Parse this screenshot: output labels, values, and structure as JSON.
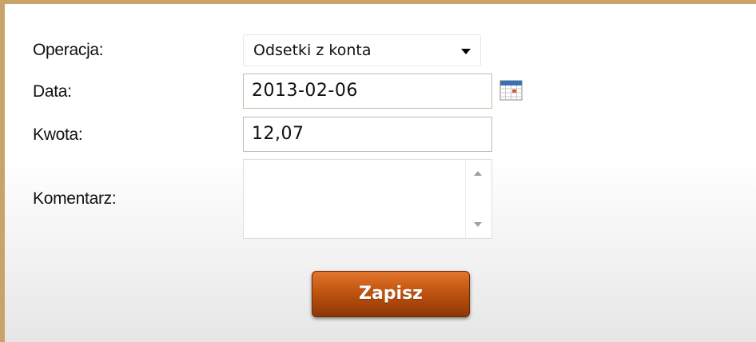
{
  "form": {
    "operation": {
      "label": "Operacja:",
      "selected": "Odsetki z konta"
    },
    "date": {
      "label": "Data:",
      "value": "2013-02-06"
    },
    "amount": {
      "label": "Kwota:",
      "value": "12,07"
    },
    "comment": {
      "label": "Komentarz:",
      "value": ""
    },
    "save_label": "Zapisz"
  },
  "colors": {
    "frame_border": "#c8a46a",
    "button_top": "#e2762e",
    "button_bottom": "#8e3606",
    "input_border": "#c9b8a8"
  },
  "icons": {
    "date_picker": "calendar-icon",
    "select_arrow": "chevron-down-icon"
  }
}
